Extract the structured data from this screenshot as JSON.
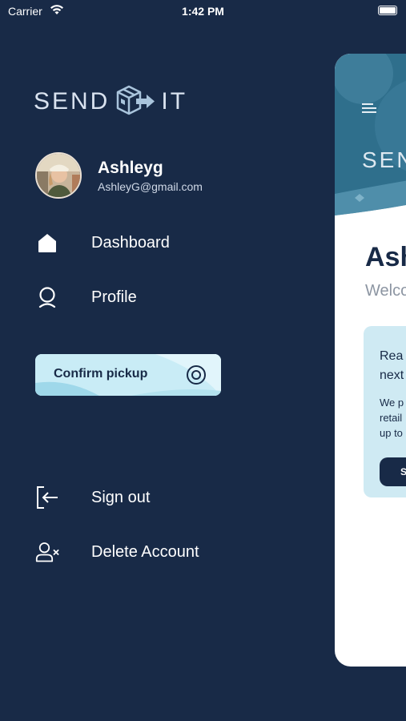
{
  "status_bar": {
    "carrier": "Carrier",
    "time": "1:42 PM"
  },
  "logo": {
    "left_text": "SEND",
    "right_text": "IT",
    "icon": "box-arrow-icon"
  },
  "user": {
    "name": "Ashleyg",
    "email": "AshleyG@gmail.com"
  },
  "menu": {
    "dashboard": {
      "label": "Dashboard",
      "icon": "home-icon"
    },
    "profile": {
      "label": "Profile",
      "icon": "user-icon"
    },
    "confirm_pickup": {
      "label": "Confirm pickup",
      "icon": "target-icon"
    },
    "sign_out": {
      "label": "Sign out",
      "icon": "sign-out-icon"
    },
    "delete_account": {
      "label": "Delete Account",
      "icon": "user-remove-icon"
    }
  },
  "peek": {
    "header_text": "SEN",
    "greeting": "Ash",
    "welcome": "Welco",
    "info_title": "Rea\nnext",
    "info_body": "We p\nretail\nup to",
    "button_label": "S"
  },
  "colors": {
    "background": "#182a47",
    "accent": "#cdeef7",
    "card": "#ffffff"
  }
}
